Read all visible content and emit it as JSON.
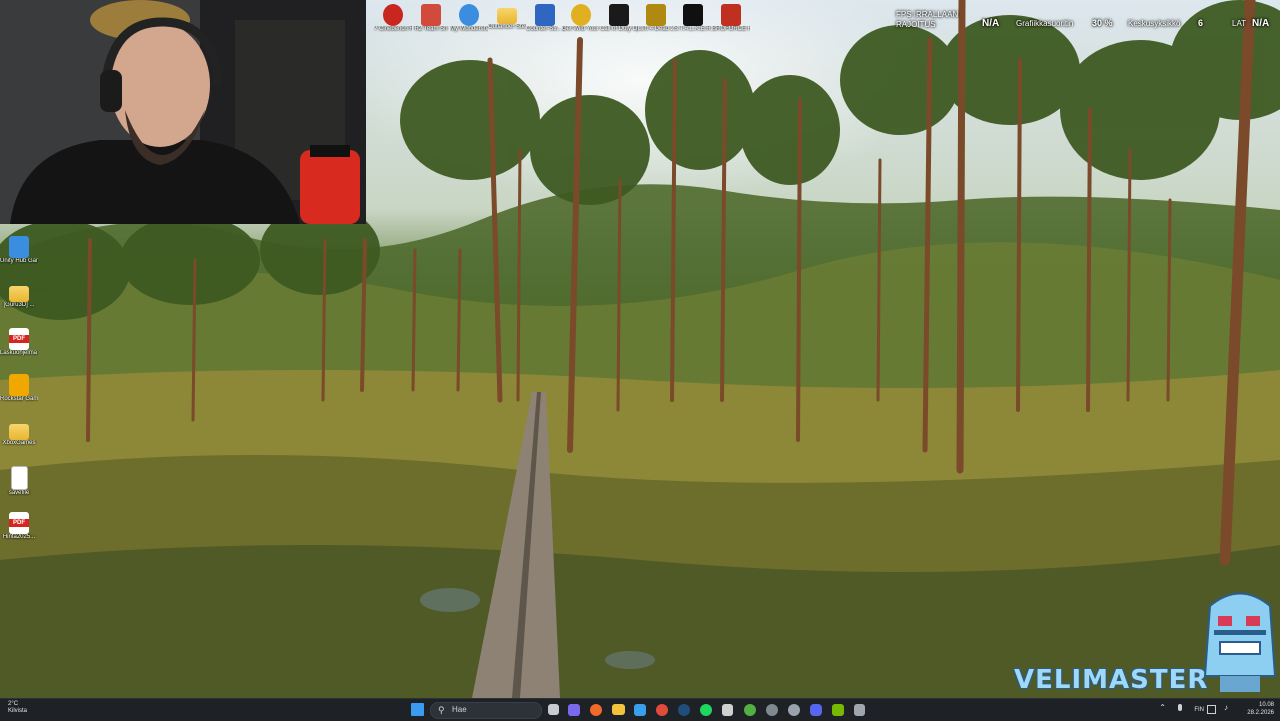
{
  "desktop_top_icons": [
    {
      "label": "? Cinebench Register",
      "icon": "red-logo-icon",
      "color": "#c8261e"
    },
    {
      "label": "R2 Team Sh",
      "icon": "game-icon",
      "color": "#d24a3b"
    },
    {
      "label": "My Wondershare Co...",
      "icon": "swirl-icon",
      "color": "#3b8de0"
    },
    {
      "label": "Outlander Steam",
      "icon": "folder-icon",
      "color": "#f5c542"
    },
    {
      "label": "Counter-Str... 2",
      "icon": "cs-icon",
      "color": "#2f66c2"
    },
    {
      "label": "Get Wild Your Friend",
      "icon": "chrome-icon",
      "color": "#e0b020"
    },
    {
      "label": "Call of Duty Operation XI",
      "icon": "cod-icon",
      "color": "#1a1a1a"
    },
    {
      "label": "Left 4 Dead 2",
      "icon": "l4d-icon",
      "color": "#b08a10"
    },
    {
      "label": "S.T.A.L.K.E.R. 2",
      "icon": "stalker-icon",
      "color": "#101010"
    },
    {
      "label": "BROFORCE Halloween",
      "icon": "broforce-icon",
      "color": "#c03020"
    }
  ],
  "desktop_left_icons": [
    {
      "label": "Unity Hub Game",
      "icon": "unity-icon"
    },
    {
      "label": "[Guru3D] ...",
      "icon": "folder-icon"
    },
    {
      "label": "Laskuohjelma 2024",
      "icon": "pdf-icon"
    },
    {
      "label": "Rockstar Games",
      "icon": "rockstar-icon"
    },
    {
      "label": "XboxGames",
      "icon": "folder-icon"
    },
    {
      "label": "savefile",
      "icon": "file-icon"
    },
    {
      "label": "Hinta2025...",
      "icon": "pdf-icon"
    }
  ],
  "hud": {
    "fps_label": "FPS IRRALLAAN",
    "fps_sub": "RAJOITUS",
    "fps_value": "N/A",
    "gpu_label": "Grafiikkasuoritin",
    "gpu_value": "30 %",
    "ram_label": "Keskusyksikkö",
    "ram_value": "6",
    "extra_label": "LAT",
    "extra_value": "N/A"
  },
  "branding": {
    "logo_text": "VELIMASTER",
    "logo_color": "#9fd9f5"
  },
  "taskbar": {
    "weather_temp": "2°C",
    "weather_desc": "Kilvista",
    "search_placeholder": "Hae",
    "pinned_apps": [
      {
        "name": "start-button-icon",
        "color": "#3a9cf0"
      },
      {
        "name": "task-view-icon",
        "color": "#c8ccd2"
      },
      {
        "name": "teams-icon",
        "color": "#7b68ee"
      },
      {
        "name": "firefox-icon",
        "color": "#f06a2a"
      },
      {
        "name": "file-explorer-icon",
        "color": "#f3c33e"
      },
      {
        "name": "store-icon",
        "color": "#3aa0ee"
      },
      {
        "name": "chrome-icon",
        "color": "#e24a3b"
      },
      {
        "name": "steam-icon",
        "color": "#1f4e7a"
      },
      {
        "name": "spotify-icon",
        "color": "#1ed760"
      },
      {
        "name": "epic-icon",
        "color": "#d0d0d0"
      },
      {
        "name": "xbox-icon",
        "color": "#52b043"
      },
      {
        "name": "obs-icon",
        "color": "#808890"
      },
      {
        "name": "settings-icon",
        "color": "#9aa2ad"
      },
      {
        "name": "discord-icon",
        "color": "#5865f2"
      },
      {
        "name": "nvidia-icon",
        "color": "#76b900"
      },
      {
        "name": "calculator-icon",
        "color": "#a0a6ad"
      }
    ],
    "tray_language": "FIN",
    "clock_time": "10.08",
    "clock_date": "28.2.2026"
  }
}
